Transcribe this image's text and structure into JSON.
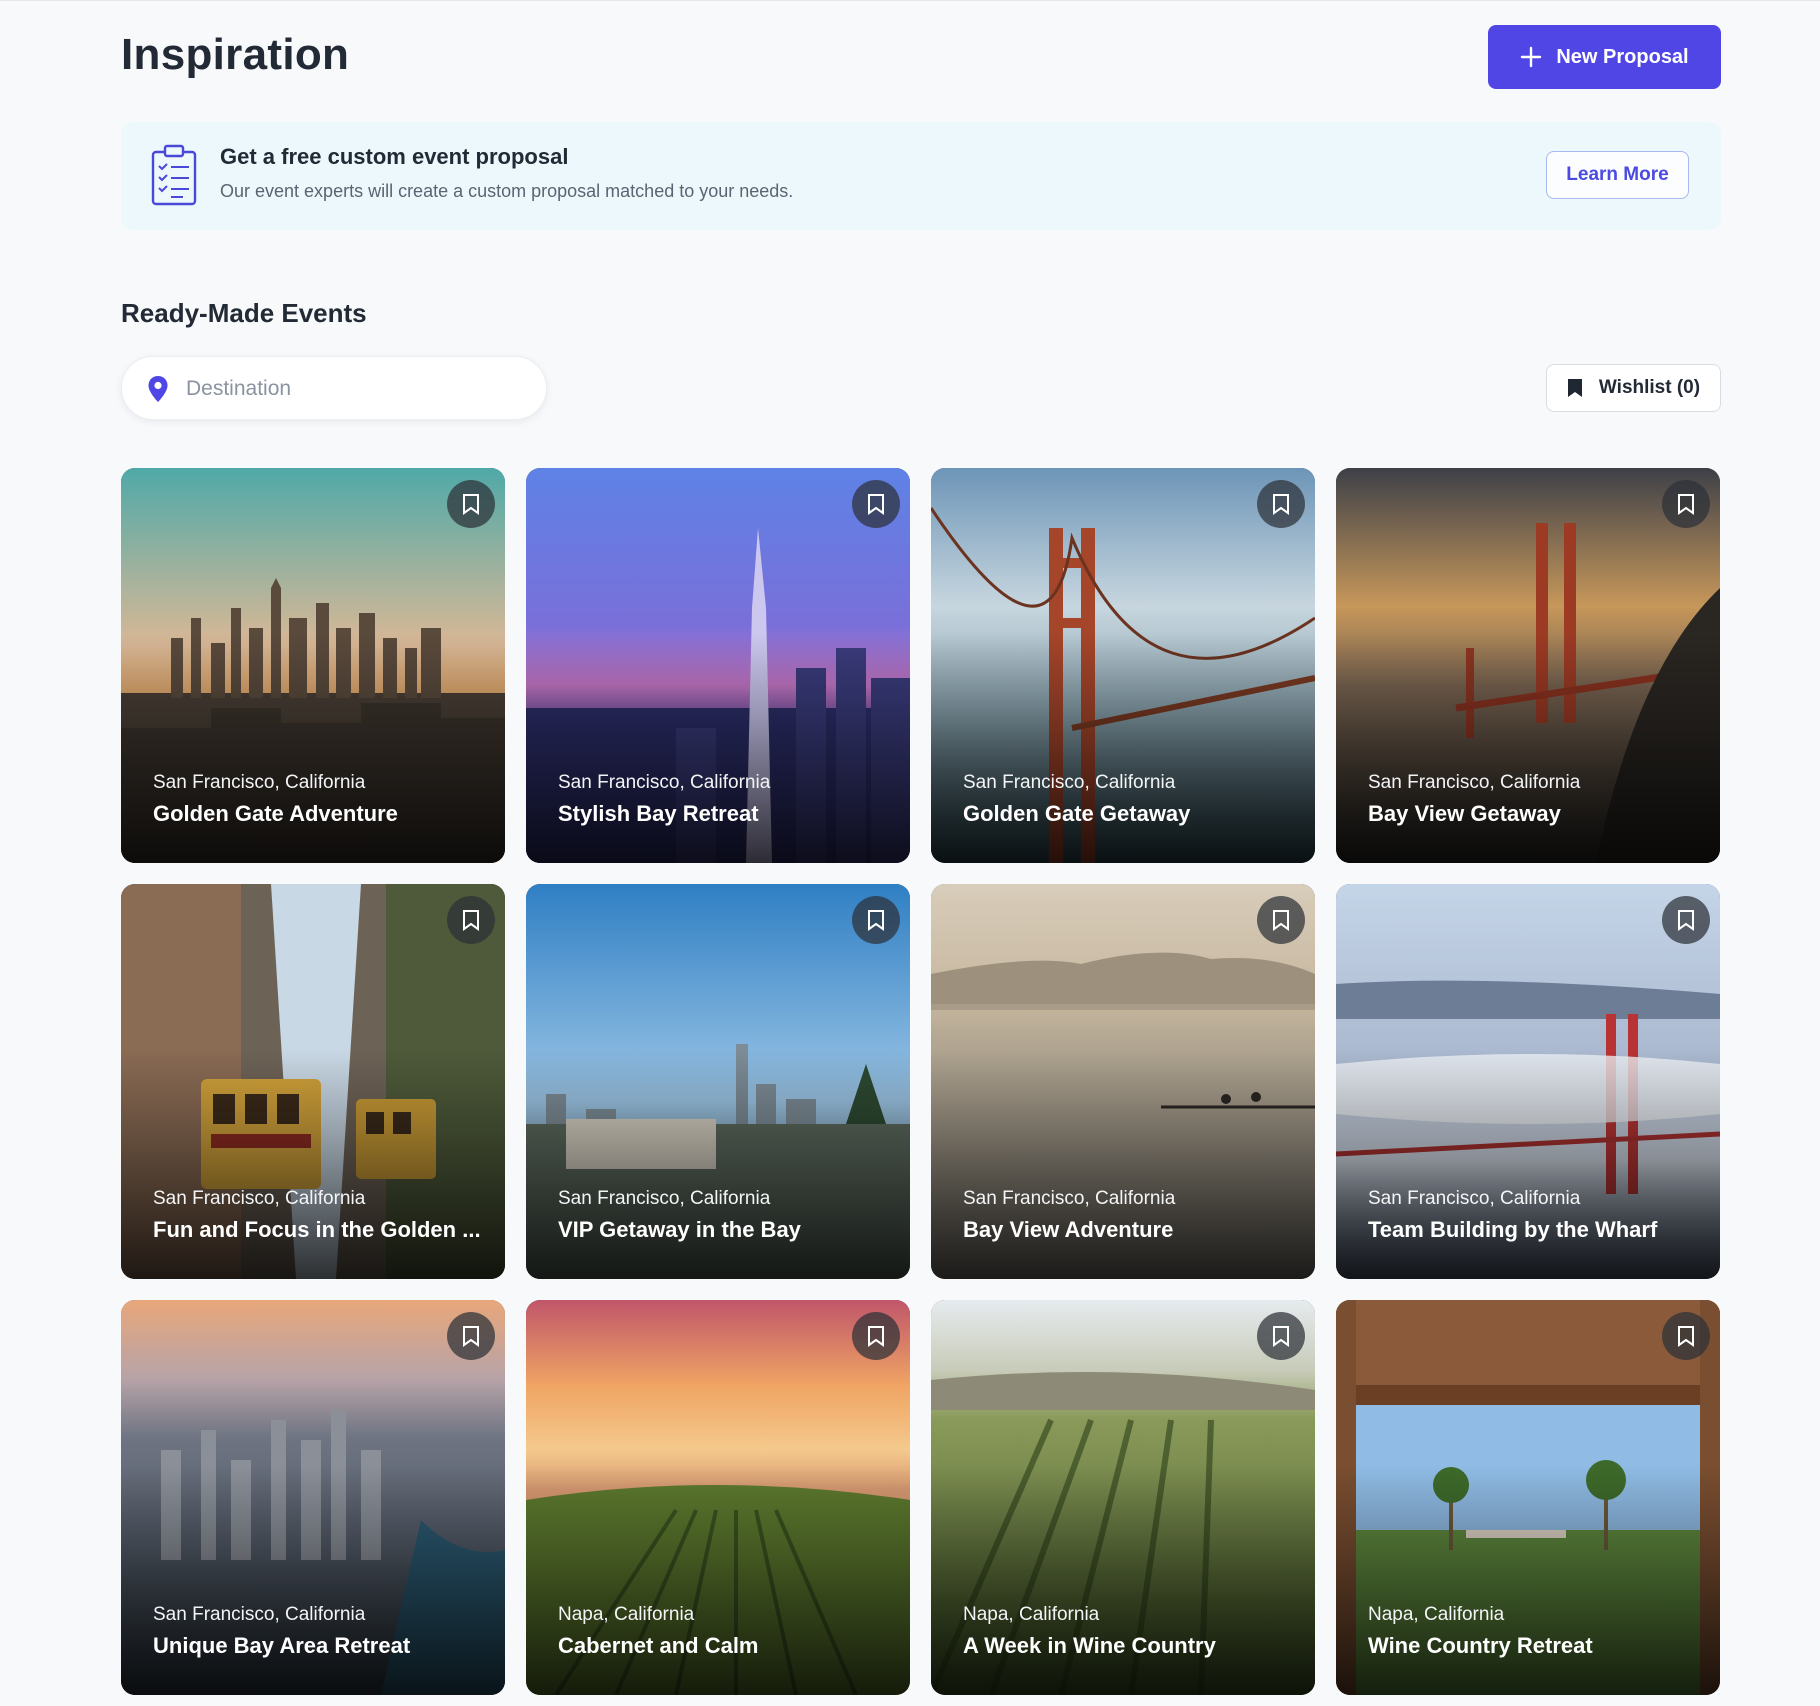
{
  "header": {
    "title": "Inspiration",
    "new_proposal_label": "New Proposal"
  },
  "banner": {
    "title": "Get a free custom event proposal",
    "subtitle": "Our event experts will create a custom proposal matched to your needs.",
    "learn_more_label": "Learn More"
  },
  "section": {
    "title": "Ready-Made Events"
  },
  "search": {
    "placeholder": "Destination",
    "value": ""
  },
  "wishlist": {
    "label": "Wishlist (0)"
  },
  "colors": {
    "accent": "#5046e5",
    "banner_bg": "#ecf8fb",
    "page_bg": "#f8f9fb"
  },
  "events": [
    {
      "location": "San Francisco, California",
      "name": "Golden Gate Adventure"
    },
    {
      "location": "San Francisco, California",
      "name": "Stylish Bay Retreat"
    },
    {
      "location": "San Francisco, California",
      "name": "Golden Gate Getaway"
    },
    {
      "location": "San Francisco, California",
      "name": "Bay View Getaway"
    },
    {
      "location": "San Francisco, California",
      "name": "Fun and Focus in the Golden ..."
    },
    {
      "location": "San Francisco, California",
      "name": "VIP Getaway in the Bay"
    },
    {
      "location": "San Francisco, California",
      "name": "Bay View Adventure"
    },
    {
      "location": "San Francisco, California",
      "name": "Team Building by the Wharf"
    },
    {
      "location": "San Francisco, California",
      "name": "Unique Bay Area Retreat"
    },
    {
      "location": "Napa, California",
      "name": "Cabernet and Calm"
    },
    {
      "location": "Napa, California",
      "name": "A Week in Wine Country"
    },
    {
      "location": "Napa, California",
      "name": "Wine Country Retreat"
    }
  ]
}
